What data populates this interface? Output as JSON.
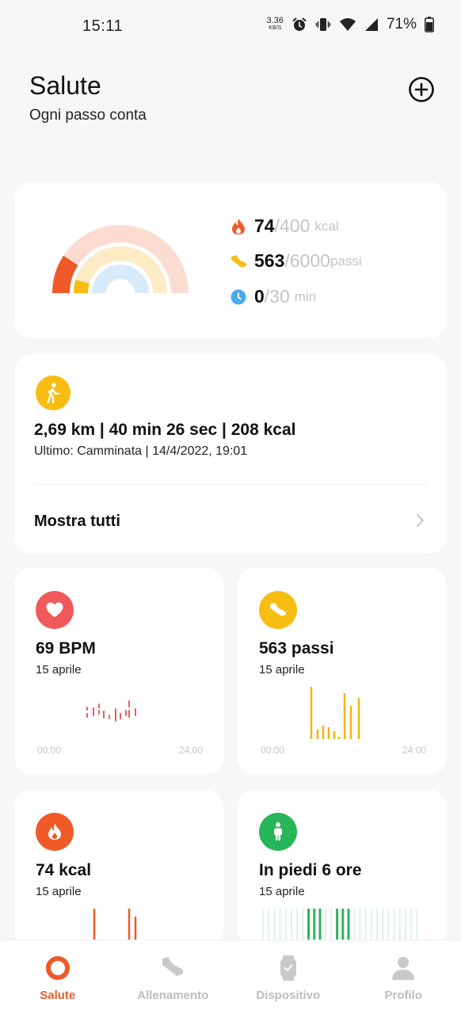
{
  "status_bar": {
    "time": "15:11",
    "net_speed": "3.36",
    "net_unit": "KB/S",
    "battery": "71%"
  },
  "header": {
    "title": "Salute",
    "subtitle": "Ogni passo conta"
  },
  "activity": {
    "calories": {
      "current": "74",
      "goal": "/400",
      "unit": "kcal",
      "color": "#f05a28",
      "progress": 0.185
    },
    "steps": {
      "current": "563",
      "goal": "/6000",
      "unit": "passi",
      "color": "#f7bd12",
      "progress": 0.094
    },
    "minutes": {
      "current": "0",
      "goal": "/30",
      "unit": "min",
      "color": "#4aa8ef",
      "progress": 0.0
    }
  },
  "last_workout": {
    "summary": "2,69 km | 40 min 26 sec | 208 kcal",
    "detail": "Ultimo: Camminata | 14/4/2022, 19:01",
    "show_all": "Mostra tutti"
  },
  "tiles": {
    "heart_rate": {
      "value": "69 BPM",
      "date": "15 aprile",
      "axis_start": "00:00",
      "axis_end": "24:00",
      "color": "#f0595a"
    },
    "steps": {
      "value": "563 passi",
      "date": "15 aprile",
      "axis_start": "00:00",
      "axis_end": "24:00",
      "color": "#f7bd12"
    },
    "calories": {
      "value": "74 kcal",
      "date": "15 aprile",
      "color": "#f05a28"
    },
    "standing": {
      "value": "In piedi 6 ore",
      "date": "15 aprile",
      "color": "#27b55a"
    }
  },
  "bottom_nav": [
    {
      "label": "Salute",
      "icon": "health-ring-icon",
      "active": true
    },
    {
      "label": "Allenamento",
      "icon": "shoe-icon",
      "active": false
    },
    {
      "label": "Dispositivo",
      "icon": "watch-icon",
      "active": false
    },
    {
      "label": "Profilo",
      "icon": "person-icon",
      "active": false
    }
  ]
}
